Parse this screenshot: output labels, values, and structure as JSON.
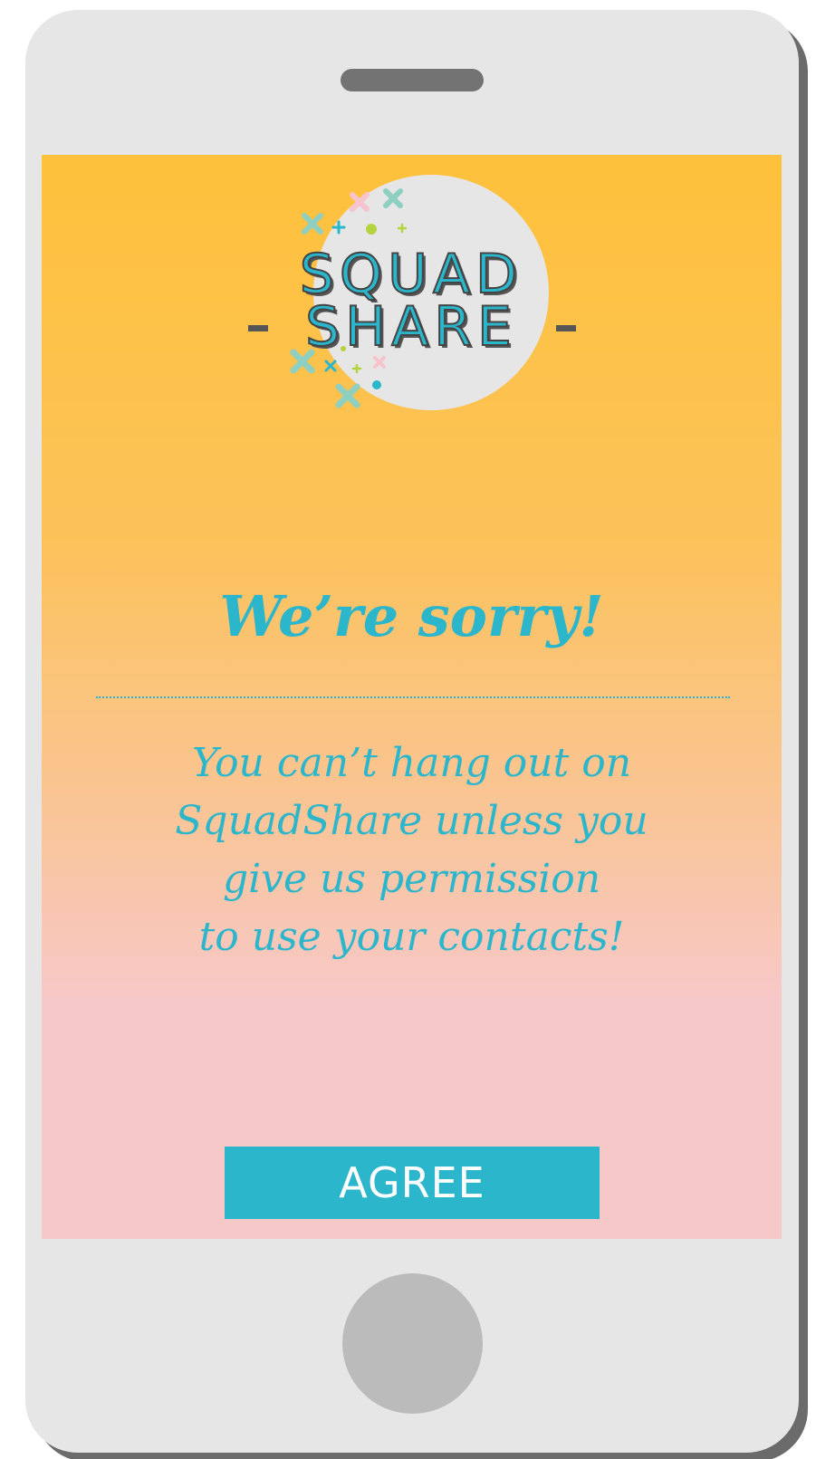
{
  "app": {
    "logo_line1": "SQUAD",
    "logo_line2": "SHARE"
  },
  "dialog": {
    "headline": "We’re sorry!",
    "message_lines": [
      "You can’t hang out on",
      "SquadShare unless you",
      "give us permission",
      "to use your contacts!"
    ],
    "agree_label": "AGREE"
  },
  "colors": {
    "accent": "#2bb6cc",
    "gradient_top": "#fec13b",
    "gradient_bottom": "#f7c8c8",
    "phone_body": "#e6e6e6",
    "logo_circle": "#e6e6e6"
  },
  "icons": {
    "logo_decoration": "confetti-crosses-icon",
    "speaker": "speaker-slot-icon",
    "home": "home-button-icon"
  }
}
